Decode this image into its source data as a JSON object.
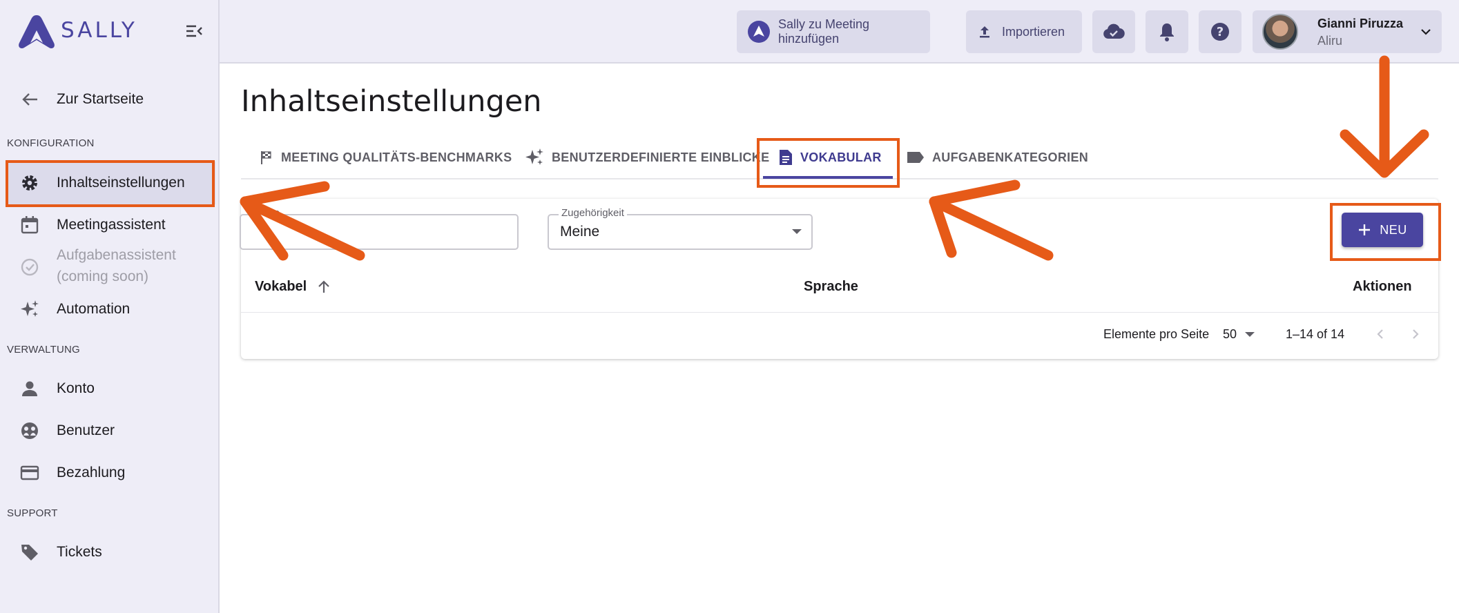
{
  "app": {
    "logo_text": "SALLY"
  },
  "sidebar": {
    "back_label": "Zur Startseite",
    "sections": {
      "config": "KONFIGURATION",
      "admin": "VERWALTUNG",
      "support": "SUPPORT"
    },
    "items": [
      {
        "label": "Inhaltseinstellungen",
        "icon": "gear-icon",
        "active": true
      },
      {
        "label": "Meetingassistent",
        "icon": "calendar-icon"
      },
      {
        "label_line1": "Aufgabenassistent",
        "label_line2": "(coming soon)",
        "icon": "check-circle-icon",
        "disabled": true
      },
      {
        "label": "Automation",
        "icon": "sparkle-icon"
      },
      {
        "label": "Konto",
        "icon": "person-icon"
      },
      {
        "label": "Benutzer",
        "icon": "users-icon"
      },
      {
        "label": "Bezahlung",
        "icon": "credit-card-icon"
      },
      {
        "label": "Tickets",
        "icon": "tag-icon"
      }
    ]
  },
  "topbar": {
    "add_to_meeting": "Sally zu Meeting hinzufügen",
    "import": "Importieren",
    "user": {
      "name": "Gianni Piruzza",
      "org": "Aliru"
    }
  },
  "main": {
    "title": "Inhaltseinstellungen",
    "tabs": [
      {
        "label": "MEETING QUALITÄTS-BENCHMARKS",
        "icon": "flag-icon"
      },
      {
        "label": "BENUTZERDEFINIERTE EINBLICKE",
        "icon": "sparkle-icon"
      },
      {
        "label": "VOKABULAR",
        "icon": "document-icon",
        "active": true
      },
      {
        "label": "AUFGABENKATEGORIEN",
        "icon": "label-icon"
      }
    ],
    "search": {
      "label": "che",
      "value": ""
    },
    "affiliation": {
      "label": "Zugehörigkeit",
      "value": "Meine"
    },
    "new_button": "NEU",
    "table": {
      "columns": [
        "Vokabel",
        "Sprache",
        "Aktionen"
      ],
      "rows": []
    },
    "pagination": {
      "per_page_label": "Elemente pro Seite",
      "per_page": "50",
      "range": "1–14 of 14"
    }
  },
  "colors": {
    "accent": "#4a45a0",
    "highlight": "#e65a18",
    "sidebar_bg": "#eeedf7"
  }
}
